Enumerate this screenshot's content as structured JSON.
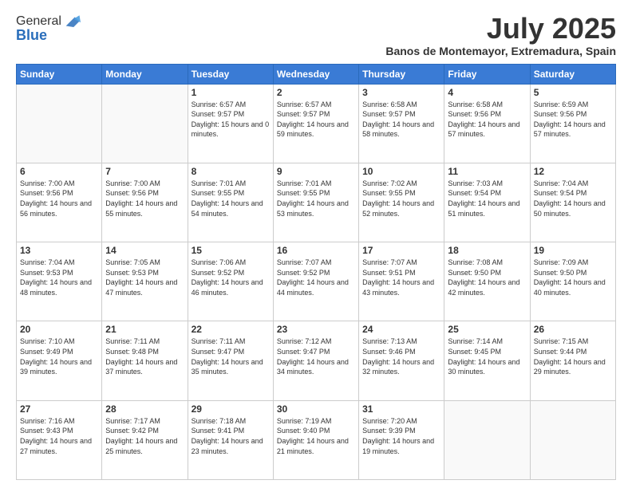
{
  "header": {
    "logo_general": "General",
    "logo_blue": "Blue",
    "month_title": "July 2025",
    "location": "Banos de Montemayor, Extremadura, Spain"
  },
  "weekdays": [
    "Sunday",
    "Monday",
    "Tuesday",
    "Wednesday",
    "Thursday",
    "Friday",
    "Saturday"
  ],
  "weeks": [
    [
      {
        "day": "",
        "sunrise": "",
        "sunset": "",
        "daylight": ""
      },
      {
        "day": "",
        "sunrise": "",
        "sunset": "",
        "daylight": ""
      },
      {
        "day": "1",
        "sunrise": "Sunrise: 6:57 AM",
        "sunset": "Sunset: 9:57 PM",
        "daylight": "Daylight: 15 hours and 0 minutes."
      },
      {
        "day": "2",
        "sunrise": "Sunrise: 6:57 AM",
        "sunset": "Sunset: 9:57 PM",
        "daylight": "Daylight: 14 hours and 59 minutes."
      },
      {
        "day": "3",
        "sunrise": "Sunrise: 6:58 AM",
        "sunset": "Sunset: 9:57 PM",
        "daylight": "Daylight: 14 hours and 58 minutes."
      },
      {
        "day": "4",
        "sunrise": "Sunrise: 6:58 AM",
        "sunset": "Sunset: 9:56 PM",
        "daylight": "Daylight: 14 hours and 57 minutes."
      },
      {
        "day": "5",
        "sunrise": "Sunrise: 6:59 AM",
        "sunset": "Sunset: 9:56 PM",
        "daylight": "Daylight: 14 hours and 57 minutes."
      }
    ],
    [
      {
        "day": "6",
        "sunrise": "Sunrise: 7:00 AM",
        "sunset": "Sunset: 9:56 PM",
        "daylight": "Daylight: 14 hours and 56 minutes."
      },
      {
        "day": "7",
        "sunrise": "Sunrise: 7:00 AM",
        "sunset": "Sunset: 9:56 PM",
        "daylight": "Daylight: 14 hours and 55 minutes."
      },
      {
        "day": "8",
        "sunrise": "Sunrise: 7:01 AM",
        "sunset": "Sunset: 9:55 PM",
        "daylight": "Daylight: 14 hours and 54 minutes."
      },
      {
        "day": "9",
        "sunrise": "Sunrise: 7:01 AM",
        "sunset": "Sunset: 9:55 PM",
        "daylight": "Daylight: 14 hours and 53 minutes."
      },
      {
        "day": "10",
        "sunrise": "Sunrise: 7:02 AM",
        "sunset": "Sunset: 9:55 PM",
        "daylight": "Daylight: 14 hours and 52 minutes."
      },
      {
        "day": "11",
        "sunrise": "Sunrise: 7:03 AM",
        "sunset": "Sunset: 9:54 PM",
        "daylight": "Daylight: 14 hours and 51 minutes."
      },
      {
        "day": "12",
        "sunrise": "Sunrise: 7:04 AM",
        "sunset": "Sunset: 9:54 PM",
        "daylight": "Daylight: 14 hours and 50 minutes."
      }
    ],
    [
      {
        "day": "13",
        "sunrise": "Sunrise: 7:04 AM",
        "sunset": "Sunset: 9:53 PM",
        "daylight": "Daylight: 14 hours and 48 minutes."
      },
      {
        "day": "14",
        "sunrise": "Sunrise: 7:05 AM",
        "sunset": "Sunset: 9:53 PM",
        "daylight": "Daylight: 14 hours and 47 minutes."
      },
      {
        "day": "15",
        "sunrise": "Sunrise: 7:06 AM",
        "sunset": "Sunset: 9:52 PM",
        "daylight": "Daylight: 14 hours and 46 minutes."
      },
      {
        "day": "16",
        "sunrise": "Sunrise: 7:07 AM",
        "sunset": "Sunset: 9:52 PM",
        "daylight": "Daylight: 14 hours and 44 minutes."
      },
      {
        "day": "17",
        "sunrise": "Sunrise: 7:07 AM",
        "sunset": "Sunset: 9:51 PM",
        "daylight": "Daylight: 14 hours and 43 minutes."
      },
      {
        "day": "18",
        "sunrise": "Sunrise: 7:08 AM",
        "sunset": "Sunset: 9:50 PM",
        "daylight": "Daylight: 14 hours and 42 minutes."
      },
      {
        "day": "19",
        "sunrise": "Sunrise: 7:09 AM",
        "sunset": "Sunset: 9:50 PM",
        "daylight": "Daylight: 14 hours and 40 minutes."
      }
    ],
    [
      {
        "day": "20",
        "sunrise": "Sunrise: 7:10 AM",
        "sunset": "Sunset: 9:49 PM",
        "daylight": "Daylight: 14 hours and 39 minutes."
      },
      {
        "day": "21",
        "sunrise": "Sunrise: 7:11 AM",
        "sunset": "Sunset: 9:48 PM",
        "daylight": "Daylight: 14 hours and 37 minutes."
      },
      {
        "day": "22",
        "sunrise": "Sunrise: 7:11 AM",
        "sunset": "Sunset: 9:47 PM",
        "daylight": "Daylight: 14 hours and 35 minutes."
      },
      {
        "day": "23",
        "sunrise": "Sunrise: 7:12 AM",
        "sunset": "Sunset: 9:47 PM",
        "daylight": "Daylight: 14 hours and 34 minutes."
      },
      {
        "day": "24",
        "sunrise": "Sunrise: 7:13 AM",
        "sunset": "Sunset: 9:46 PM",
        "daylight": "Daylight: 14 hours and 32 minutes."
      },
      {
        "day": "25",
        "sunrise": "Sunrise: 7:14 AM",
        "sunset": "Sunset: 9:45 PM",
        "daylight": "Daylight: 14 hours and 30 minutes."
      },
      {
        "day": "26",
        "sunrise": "Sunrise: 7:15 AM",
        "sunset": "Sunset: 9:44 PM",
        "daylight": "Daylight: 14 hours and 29 minutes."
      }
    ],
    [
      {
        "day": "27",
        "sunrise": "Sunrise: 7:16 AM",
        "sunset": "Sunset: 9:43 PM",
        "daylight": "Daylight: 14 hours and 27 minutes."
      },
      {
        "day": "28",
        "sunrise": "Sunrise: 7:17 AM",
        "sunset": "Sunset: 9:42 PM",
        "daylight": "Daylight: 14 hours and 25 minutes."
      },
      {
        "day": "29",
        "sunrise": "Sunrise: 7:18 AM",
        "sunset": "Sunset: 9:41 PM",
        "daylight": "Daylight: 14 hours and 23 minutes."
      },
      {
        "day": "30",
        "sunrise": "Sunrise: 7:19 AM",
        "sunset": "Sunset: 9:40 PM",
        "daylight": "Daylight: 14 hours and 21 minutes."
      },
      {
        "day": "31",
        "sunrise": "Sunrise: 7:20 AM",
        "sunset": "Sunset: 9:39 PM",
        "daylight": "Daylight: 14 hours and 19 minutes."
      },
      {
        "day": "",
        "sunrise": "",
        "sunset": "",
        "daylight": ""
      },
      {
        "day": "",
        "sunrise": "",
        "sunset": "",
        "daylight": ""
      }
    ]
  ]
}
